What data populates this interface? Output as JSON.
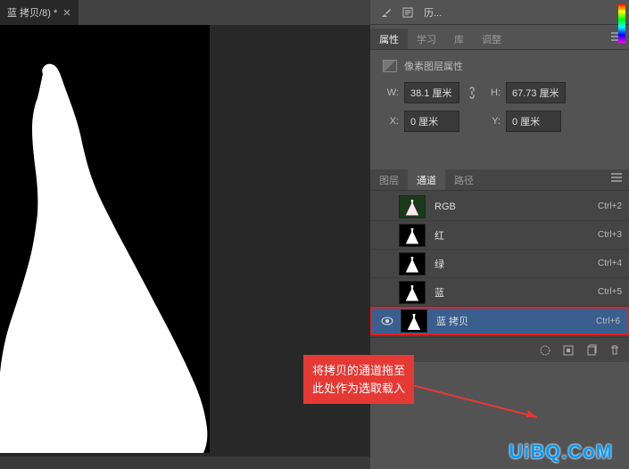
{
  "document": {
    "tab_title": "蓝 拷贝/8) *"
  },
  "history": {
    "label": "历..."
  },
  "props": {
    "tabs": {
      "properties": "属性",
      "learn": "学习",
      "library": "库",
      "adjust": "调整"
    },
    "pixel_layer_label": "像素图层属性",
    "w_label": "W:",
    "w_value": "38.1 厘米",
    "h_label": "H:",
    "h_value": "67.73 厘米",
    "x_label": "X:",
    "x_value": "0 厘米",
    "y_label": "Y:",
    "y_value": "0 厘米"
  },
  "channels": {
    "tabs": {
      "layers": "图层",
      "channels": "通道",
      "paths": "路径"
    },
    "items": [
      {
        "name": "RGB",
        "shortcut": "Ctrl+2",
        "visible": false,
        "bw": false
      },
      {
        "name": "红",
        "shortcut": "Ctrl+3",
        "visible": false,
        "bw": true
      },
      {
        "name": "绿",
        "shortcut": "Ctrl+4",
        "visible": false,
        "bw": true
      },
      {
        "name": "蓝",
        "shortcut": "Ctrl+5",
        "visible": false,
        "bw": true
      },
      {
        "name": "蓝 拷贝",
        "shortcut": "Ctrl+6",
        "visible": true,
        "bw": true,
        "selected": true
      }
    ]
  },
  "callout": {
    "line1": "将拷贝的通道拖至",
    "line2": "此处作为选取载入"
  },
  "watermark": "UiBQ.CoM"
}
